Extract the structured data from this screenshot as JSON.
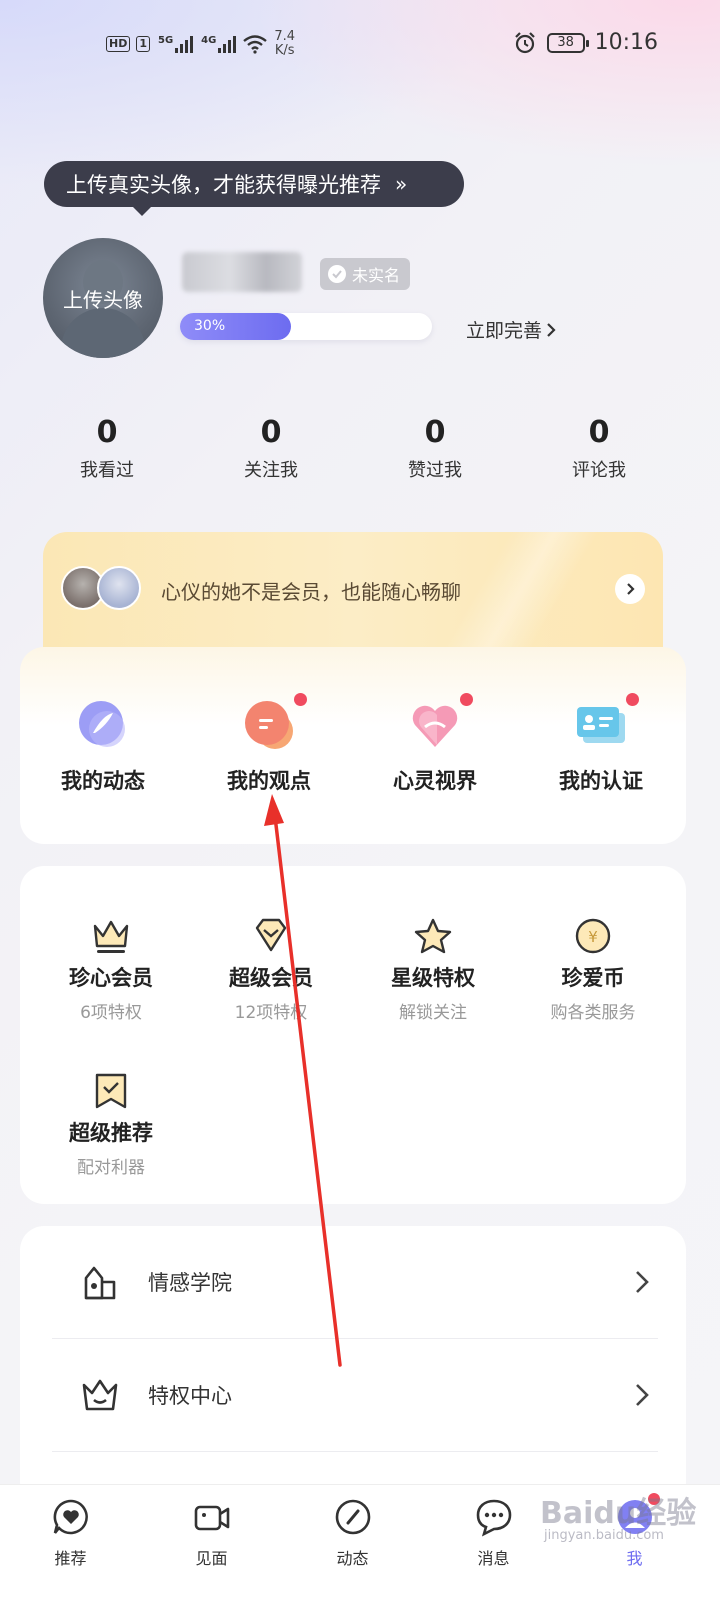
{
  "status_bar": {
    "badges": [
      "HD",
      "1"
    ],
    "network1": "5G",
    "network2": "4G",
    "speed_value": "7.4",
    "speed_unit": "K/s",
    "battery": "38",
    "time": "10:16",
    "icons": [
      "wifi-icon",
      "alarm-icon",
      "battery-icon"
    ]
  },
  "tooltip": {
    "text": "上传真实头像，才能获得曝光推荐",
    "arrow": "»"
  },
  "profile": {
    "avatar_label": "上传头像",
    "verify_badge": "未实名",
    "progress_text": "30%",
    "progress_value": 0.3,
    "complete_link": "立即完善"
  },
  "stats": [
    {
      "value": "0",
      "label": "我看过"
    },
    {
      "value": "0",
      "label": "关注我"
    },
    {
      "value": "0",
      "label": "赞过我"
    },
    {
      "value": "0",
      "label": "评论我"
    }
  ],
  "vip_banner": {
    "text": "心仪的她不是会员，也能随心畅聊"
  },
  "features": [
    {
      "label": "我的动态",
      "icon": "feather-icon",
      "dot": false
    },
    {
      "label": "我的观点",
      "icon": "chat-bubble-icon",
      "dot": true
    },
    {
      "label": "心灵视界",
      "icon": "heart-icon",
      "dot": true
    },
    {
      "label": "我的认证",
      "icon": "id-card-icon",
      "dot": true
    }
  ],
  "vip_items": [
    {
      "title": "珍心会员",
      "sub": "6项特权",
      "icon": "crown-icon"
    },
    {
      "title": "超级会员",
      "sub": "12项特权",
      "icon": "diamond-icon"
    },
    {
      "title": "星级特权",
      "sub": "解锁关注",
      "icon": "star-icon"
    },
    {
      "title": "珍爱币",
      "sub": "购各类服务",
      "icon": "coin-icon"
    },
    {
      "title": "超级推荐",
      "sub": "配对利器",
      "icon": "bookmark-icon"
    }
  ],
  "list": [
    {
      "label": "情感学院",
      "icon": "house-icon"
    },
    {
      "label": "特权中心",
      "icon": "crown-outline-icon"
    }
  ],
  "tabs": [
    {
      "label": "推荐",
      "icon": "heart-chat-icon",
      "active": false
    },
    {
      "label": "见面",
      "icon": "video-icon",
      "active": false
    },
    {
      "label": "动态",
      "icon": "compass-icon",
      "active": false
    },
    {
      "label": "消息",
      "icon": "message-icon",
      "active": false
    },
    {
      "label": "我",
      "icon": "me-icon",
      "active": true
    }
  ],
  "watermark": {
    "text": "Baidu经验",
    "sub": "jingyan.baidu.com"
  },
  "colors": {
    "accent": "#6d6cf0",
    "dot": "#f04b5f",
    "tooltip_bg": "#3c3d4b",
    "vip_banner": "#fcedc6",
    "annotation_arrow": "#e8302a"
  }
}
